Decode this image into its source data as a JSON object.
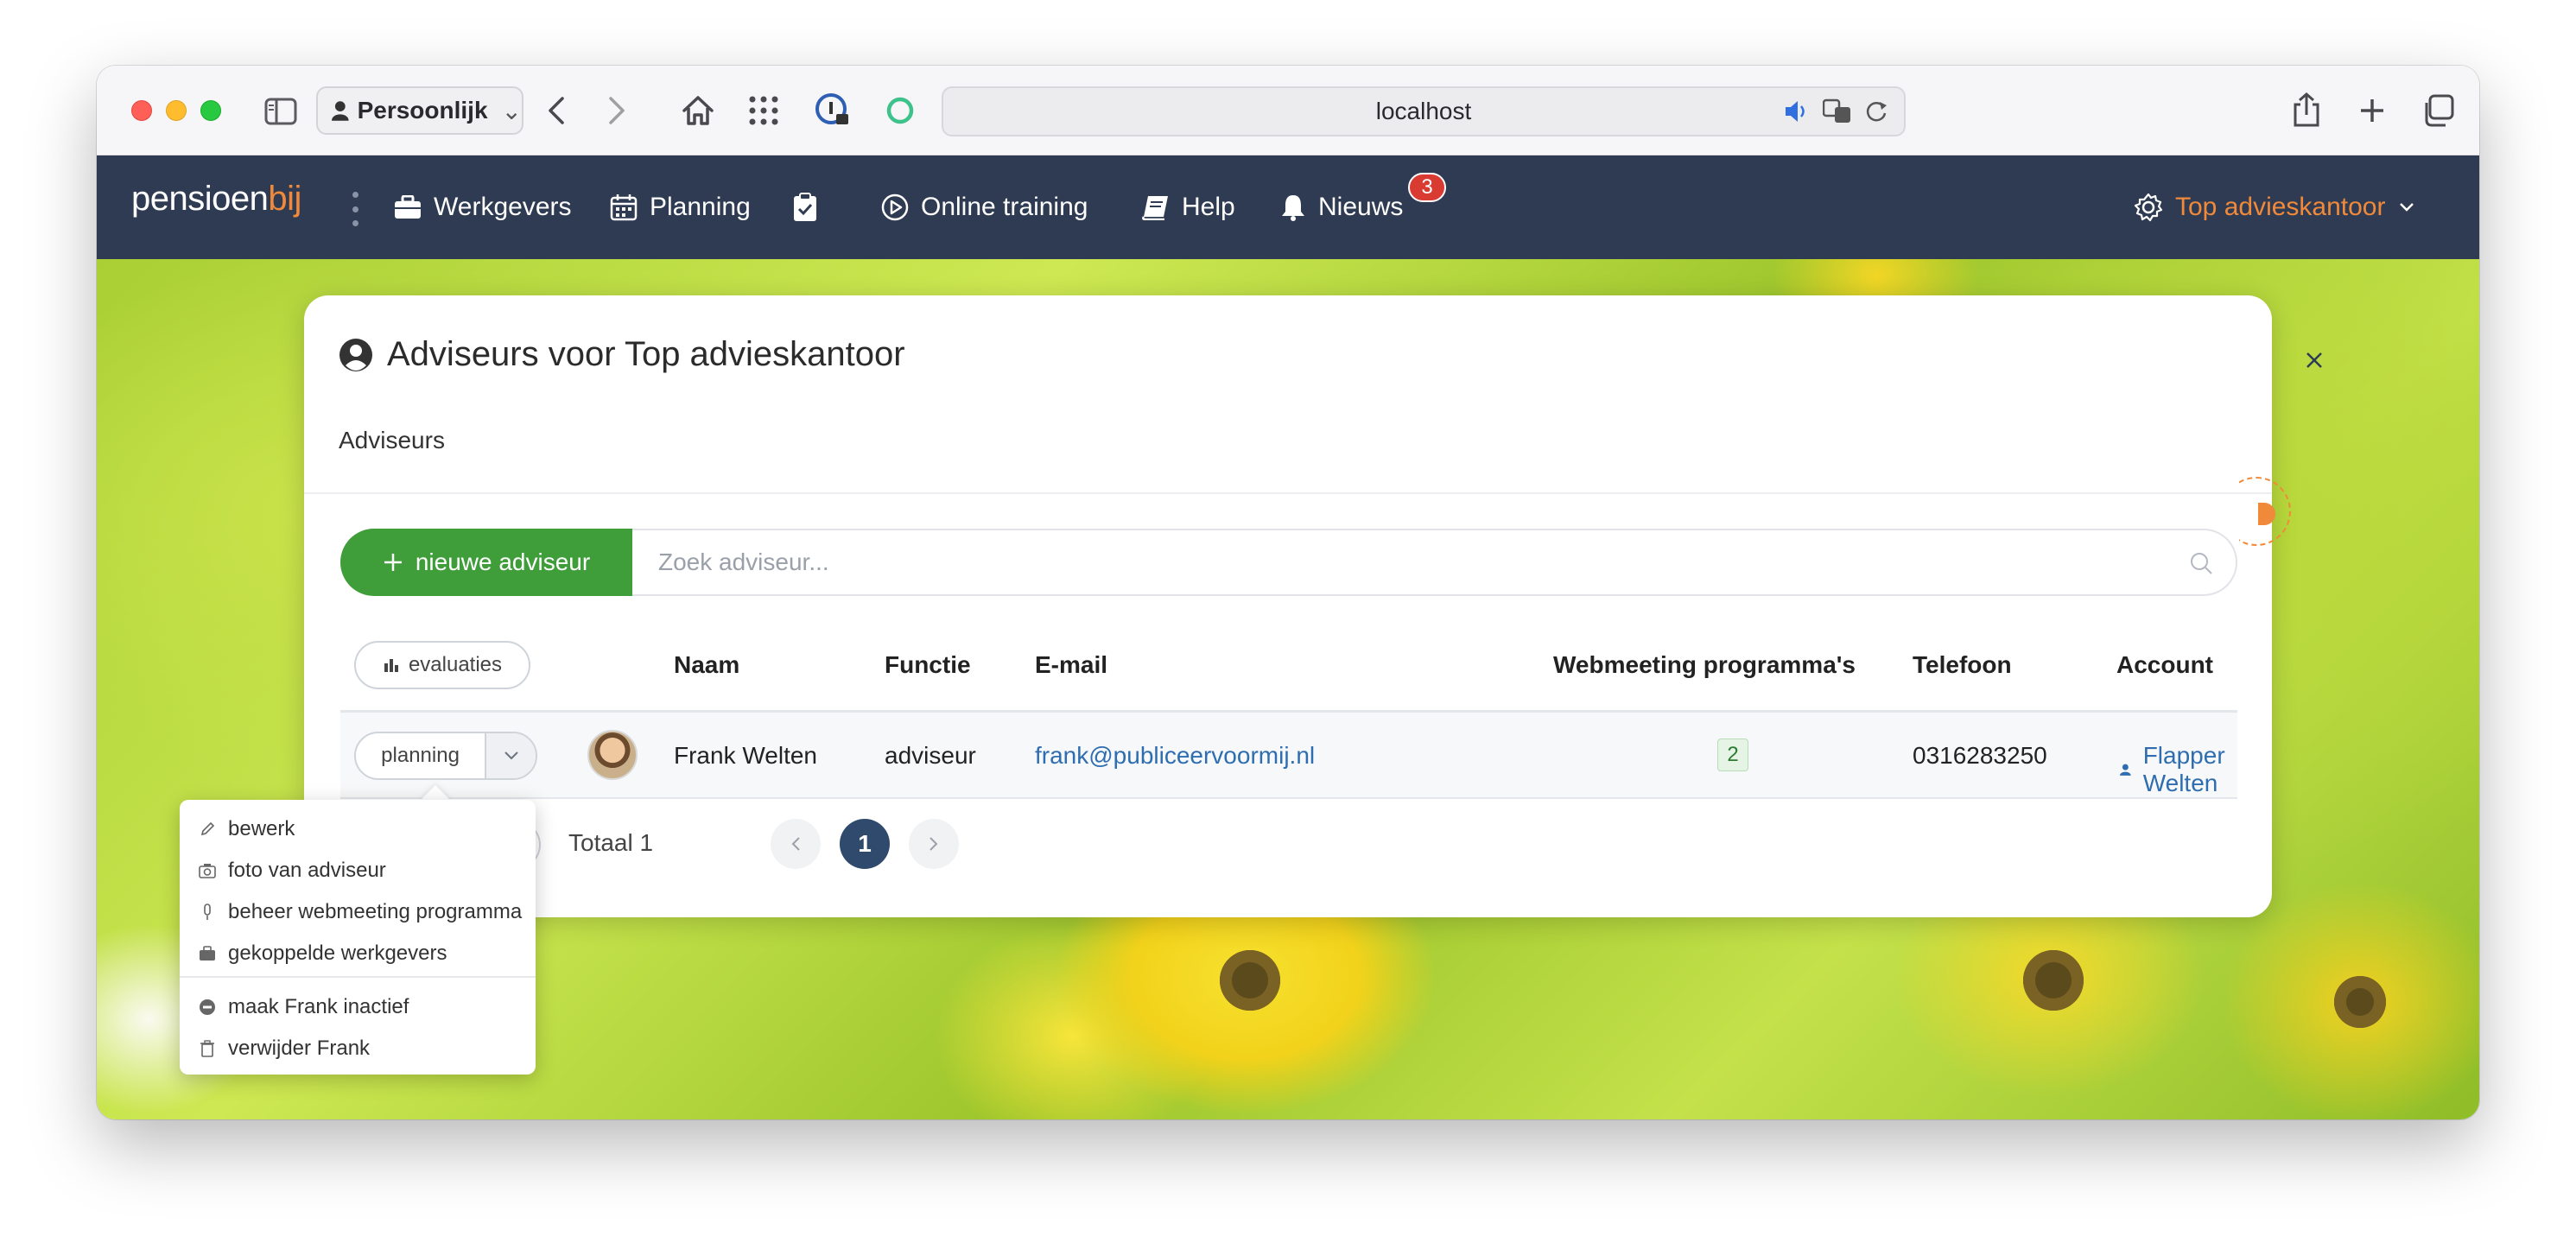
{
  "browser": {
    "profile_label": "Persoonlijk",
    "url": "localhost"
  },
  "nav": {
    "logo_main": "pensioen",
    "logo_accent": "bij",
    "items": [
      {
        "label": "Werkgevers"
      },
      {
        "label": "Planning"
      },
      {
        "label": "Online training"
      },
      {
        "label": "Help"
      },
      {
        "label": "Nieuws"
      }
    ],
    "news_badge": "3",
    "office_label": "Top advieskantoor"
  },
  "modal": {
    "title": "Adviseurs voor Top advieskantoor",
    "tab": "Adviseurs",
    "new_button": "nieuwe adviseur",
    "search_placeholder": "Zoek adviseur...",
    "evaluations_button": "evaluaties",
    "columns": [
      "Naam",
      "Functie",
      "E-mail",
      "Webmeeting programma's",
      "Telefoon",
      "Account"
    ],
    "rows": [
      {
        "planning_label": "planning",
        "naam": "Frank Welten",
        "functie": "adviseur",
        "email": "frank@publiceervoormij.nl",
        "webmeeting": "2",
        "telefoon": "0316283250",
        "account": "Flapper Welten"
      }
    ],
    "total_label": "Totaal 1",
    "current_page": "1"
  },
  "dropdown": {
    "items": [
      {
        "label": "bewerk",
        "icon": "pencil-icon"
      },
      {
        "label": "foto van adviseur",
        "icon": "camera-icon"
      },
      {
        "label": "beheer webmeeting programma",
        "icon": "microphone-icon"
      },
      {
        "label": "gekoppelde werkgevers",
        "icon": "briefcase-icon"
      },
      {
        "label": "maak Frank inactief",
        "icon": "minus-circle-icon"
      },
      {
        "label": "verwijder Frank",
        "icon": "trash-icon"
      }
    ]
  },
  "colors": {
    "nav_bg": "#2f3b52",
    "accent_orange": "#f08a3a",
    "primary_green": "#3f9d3a",
    "link_blue": "#2e6db0"
  }
}
